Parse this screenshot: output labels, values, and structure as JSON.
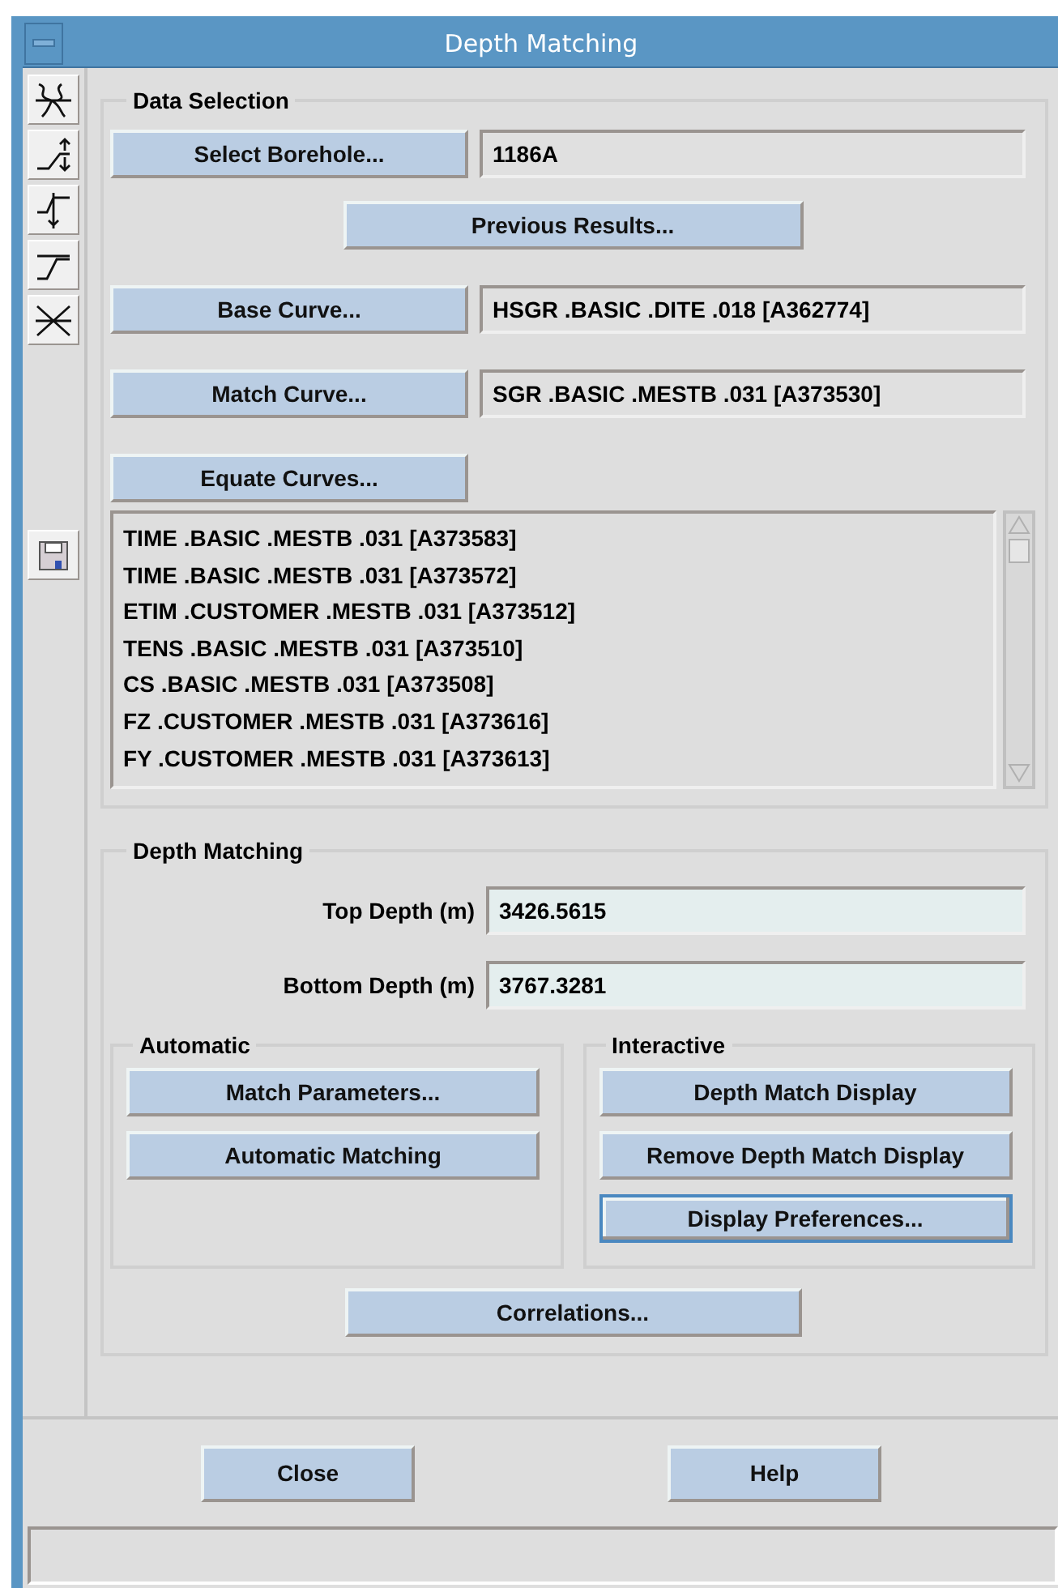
{
  "window": {
    "title": "Depth Matching"
  },
  "data_selection": {
    "title": "Data Selection",
    "borehole": {
      "button": "Select Borehole...",
      "value": "1186A"
    },
    "previous_button": "Previous Results...",
    "base_curve": {
      "button": "Base Curve...",
      "value": "HSGR .BASIC .DITE .018 [A362774]"
    },
    "match_curve": {
      "button": "Match Curve...",
      "value": "SGR .BASIC .MESTB .031 [A373530]"
    },
    "equate_button": "Equate Curves...",
    "curves": [
      "TIME .BASIC .MESTB .031 [A373583]",
      "TIME .BASIC .MESTB .031 [A373572]",
      "ETIM .CUSTOMER .MESTB .031 [A373512]",
      "TENS .BASIC .MESTB .031 [A373510]",
      "CS .BASIC .MESTB .031 [A373508]",
      "FZ .CUSTOMER .MESTB .031 [A373616]",
      "FY .CUSTOMER .MESTB .031 [A373613]"
    ]
  },
  "depth_matching": {
    "title": "Depth Matching",
    "fields": [
      {
        "label": "Top Depth (m)",
        "value": "3426.5615"
      },
      {
        "label": "Bottom Depth (m)",
        "value": "3767.3281"
      }
    ],
    "groups": [
      {
        "title": "Automatic",
        "buttons": [
          {
            "label": "Match Parameters...",
            "focused": false
          },
          {
            "label": "Automatic Matching",
            "focused": false
          }
        ]
      },
      {
        "title": "Interactive",
        "buttons": [
          {
            "label": "Depth Match Display",
            "focused": false
          },
          {
            "label": "Remove Depth Match Display",
            "focused": false
          },
          {
            "label": "Display Preferences...",
            "focused": true
          }
        ]
      }
    ],
    "correlations_button": "Correlations..."
  },
  "footer": {
    "buttons": [
      "Close",
      "Help"
    ]
  }
}
